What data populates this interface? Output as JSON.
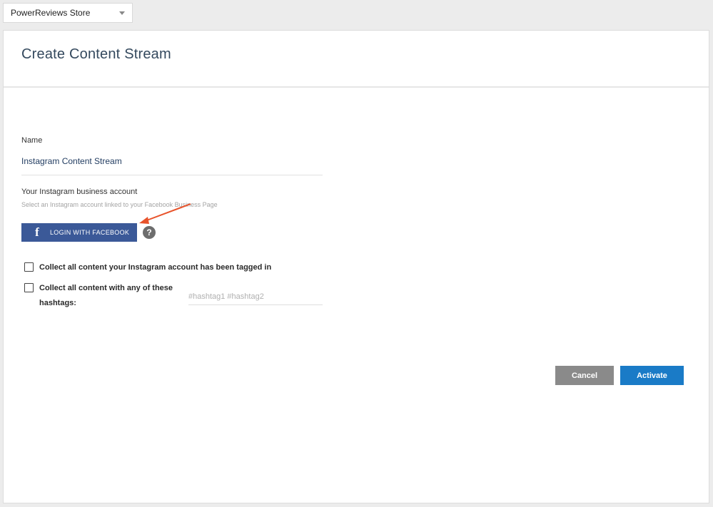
{
  "store_selector": {
    "value": "PowerReviews Store"
  },
  "panel": {
    "title": "Create Content Stream"
  },
  "form": {
    "name_label": "Name",
    "name_value": "Instagram Content Stream",
    "account_label": "Your Instagram business account",
    "account_helper": "Select an Instagram account linked to your Facebook Business Page",
    "facebook_button_label": "LOGIN WITH FACEBOOK",
    "help_icon_glyph": "?",
    "checkbox_tagged_label": "Collect all content your Instagram account has been tagged in",
    "checkbox_hashtags_label_line1": "Collect all content with any of these",
    "checkbox_hashtags_label_line2": "hashtags:",
    "hashtags_placeholder": "#hashtag1 #hashtag2",
    "hashtags_value": ""
  },
  "actions": {
    "cancel_label": "Cancel",
    "activate_label": "Activate"
  },
  "colors": {
    "facebook_blue": "#3b5998",
    "activate_blue": "#1a7bc7",
    "cancel_gray": "#8a8a8a",
    "annotation_arrow": "#e8532b",
    "title_color": "#34495e"
  },
  "icons": {
    "facebook": "facebook-icon",
    "help": "help-icon",
    "dropdown": "chevron-down-icon",
    "annotation": "arrow-annotation"
  }
}
